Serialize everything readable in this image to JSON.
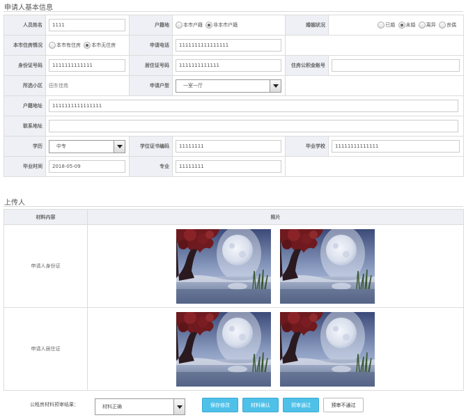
{
  "section1_title": "申请人基本信息",
  "labels": {
    "name": "人员姓名",
    "hukou": "户籍地",
    "marital": "婚姻状况",
    "housing_status": "本市住房情况",
    "phone": "申请电话",
    "id_no": "身份证号码",
    "residence_no": "居住证号码",
    "fund_no": "住房公积金账号",
    "community": "所选小区",
    "unit_type": "申请户型",
    "hukou_addr": "户籍地址",
    "contact_addr": "联系地址",
    "education": "学历",
    "degree_no": "学位证书编码",
    "school": "毕业学校",
    "grad_time": "毕业时间",
    "major": "专业"
  },
  "values": {
    "name": "1111",
    "phone": "1111111111111111",
    "id_no": "1111111111111",
    "residence_no": "1111111111111",
    "fund_no": "",
    "community": "田东佳苑",
    "unit_type": "一室一厅",
    "hukou_addr": "1111111111111111",
    "contact_addr": "",
    "education": "中专",
    "degree_no": "11111111",
    "school": "11111111111111",
    "grad_time": "2018-05-09",
    "major": "11111111"
  },
  "radios": {
    "hukou": [
      {
        "label": "本市户籍",
        "checked": false
      },
      {
        "label": "非本市户籍",
        "checked": true
      }
    ],
    "marital": [
      {
        "label": "已婚",
        "checked": false
      },
      {
        "label": "未婚",
        "checked": true
      },
      {
        "label": "离异",
        "checked": false
      },
      {
        "label": "丧偶",
        "checked": false
      }
    ],
    "housing": [
      {
        "label": "本市有住房",
        "checked": false
      },
      {
        "label": "本市无住房",
        "checked": true
      }
    ]
  },
  "section2_title": "上传人",
  "upload": {
    "col_material": "材料内容",
    "col_photo": "照片",
    "rows": [
      {
        "label": "申请人身份证"
      },
      {
        "label": "申请人居住证"
      }
    ]
  },
  "bottom": {
    "result_label": "公租房材料预审结果：",
    "result_value": "材料正确",
    "buttons": {
      "save": "保存修改",
      "confirm": "材料确认",
      "pass": "预审通过",
      "fail": "预审不通过"
    }
  },
  "colors": {
    "label_bg": "#eef0f5",
    "primary_button": "#4fc1e9",
    "border": "#dcdcdc"
  }
}
